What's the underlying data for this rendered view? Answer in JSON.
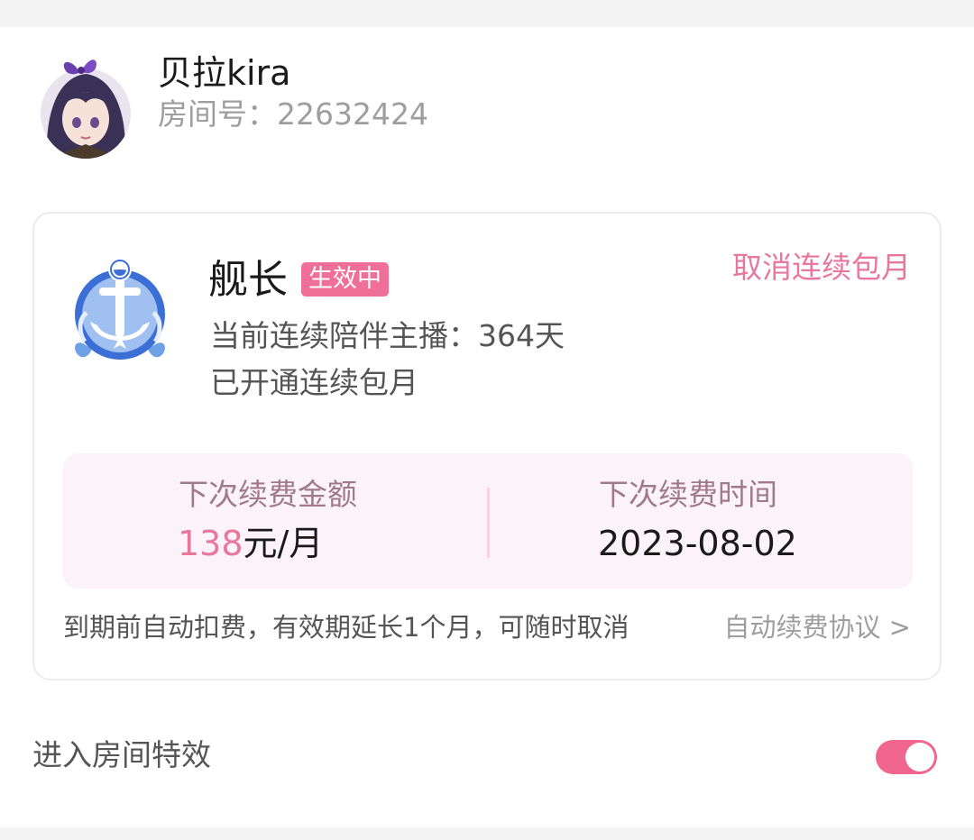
{
  "streamer": {
    "name": "贝拉kira",
    "room_label": "房间号：",
    "room_number": "22632424"
  },
  "membership": {
    "tier_name": "舰长",
    "status": "生效中",
    "cancel_label": "取消连续包月",
    "companion_line": "当前连续陪伴主播：364天",
    "renew_status": "已开通连续包月",
    "next_amount_label": "下次续费金额",
    "next_amount_value": "138",
    "next_amount_unit": "元/月",
    "next_time_label": "下次续费时间",
    "next_time_value": "2023-08-02",
    "footnote": "到期前自动扣费，有效期延长1个月，可随时取消",
    "agreement_label": "自动续费协议 >"
  },
  "settings": {
    "enter_effect_label": "进入房间特效",
    "enter_effect_enabled": true
  },
  "colors": {
    "accent": "#ef6f98",
    "link_pink": "#e8779c",
    "panel_bg": "#fcf2f9",
    "badge_blue": "#3b6fd6"
  },
  "icons": {
    "avatar": "avatar",
    "tier_badge": "anchor-badge-icon"
  }
}
